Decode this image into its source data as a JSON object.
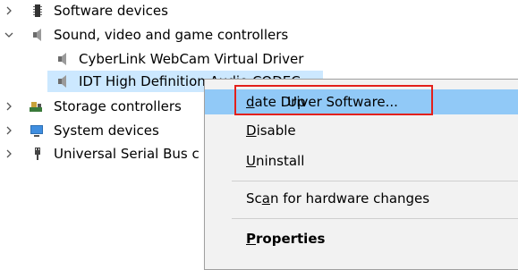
{
  "tree": {
    "items": [
      {
        "label": "Software devices",
        "icon": "chip-icon",
        "expanded": false
      },
      {
        "label": "Sound, video and game controllers",
        "icon": "speaker-icon",
        "expanded": true
      },
      {
        "label": "CyberLink WebCam Virtual Driver",
        "icon": "speaker-icon"
      },
      {
        "label": "IDT High Definition Audio CODEC",
        "icon": "speaker-icon",
        "selected": true
      },
      {
        "label": "Storage controllers",
        "icon": "storage-controller-icon",
        "expanded": false
      },
      {
        "label": "System devices",
        "icon": "monitor-icon",
        "expanded": false
      },
      {
        "label": "Universal Serial Bus c",
        "icon": "usb-icon",
        "expanded": false
      }
    ]
  },
  "menu": {
    "update": {
      "pre": "Up",
      "acc": "d",
      "post": "ate Driver Software..."
    },
    "disable": {
      "pre": "",
      "acc": "D",
      "post": "isable"
    },
    "uninstall": {
      "pre": "",
      "acc": "U",
      "post": "ninstall"
    },
    "scan": {
      "pre": "Sc",
      "acc": "a",
      "post": "n for hardware changes"
    },
    "properties": {
      "pre": "",
      "acc": "P",
      "post": "roperties"
    }
  },
  "colors": {
    "selection": "#cce8ff",
    "menu_highlight": "#91c9f7",
    "highlight_box": "#e3201b"
  }
}
